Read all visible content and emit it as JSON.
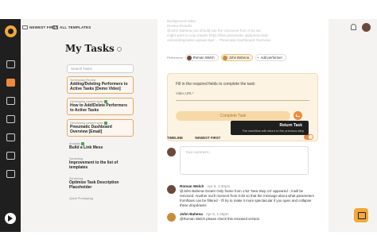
{
  "toolbar": {
    "sort_label": "NEWEST FIRST",
    "filter_label": "ALL TEMPLATES"
  },
  "tasks_panel": {
    "title": "My Tasks",
    "search_placeholder": "Search Tasks",
    "items": [
      {
        "process": "Screenplay Review",
        "title": "Adding/Deleting Performers to Active Tasks [Demo Video]",
        "boxed": true
      },
      {
        "process": "Developing content spec",
        "title": "How to Add/Delete Performers to Active Tasks",
        "boxed": true
      },
      {
        "process": "Developing content spec",
        "title": "Pneumatic Dashboard Overview [Email]",
        "boxed": true
      },
      {
        "process": "Analysis",
        "title": "Build a Link Mess",
        "boxed": false
      },
      {
        "process": "Screening",
        "title": "Improvement to the list of templates",
        "boxed": false
      },
      {
        "process": "Screening",
        "title": "Optimize Task Description Placeholder",
        "boxed": false
      },
      {
        "process": "Quick Prototyping",
        "title": "",
        "boxed": false
      }
    ]
  },
  "task_detail": {
    "previous_text": "Background video\nReview Results\n@John Bahena you should use the voiceover from 0:41 we\nmight want to crop maybe https://files.pneumatic.app/pneumatic-\nonboarding/video-upload.mp4 ... Pneumatic Dashboard Overview",
    "performers_label": "Performers",
    "performers": [
      {
        "name": "Roman Welch",
        "highlight": false
      },
      {
        "name": "John Bahena",
        "highlight": true
      }
    ],
    "add_performer": "Add performer",
    "form_heading": "Fill in the required fields to complete the task:",
    "field_label": "Video URL*",
    "complete_button": "Complete Task",
    "tooltip_title": "Return Task",
    "tooltip_text": "The workflow will return to the previous step"
  },
  "timeline": {
    "label": "TIMELINE",
    "sort": "NEWEST FIRST",
    "comments_toggle": "COMMENTS",
    "comment_placeholder": "Your comment..."
  },
  "comments": [
    {
      "author": "Roman Welch",
      "date": "Apr 5, 1:30pm",
      "text": "@John Bahena Great!! Only frame from 1:52 'New Step 1X' appeared - it will be removed. Another such moment from 0:48 so that the message about what parameters fromflows can be filtered - I'll try to make it more spectacular if you open and collapse these dropdowns"
    },
    {
      "author": "John Bahena",
      "date": "Apr 5, 1:25pm",
      "text": "@Roman Welch please check this renewed version"
    }
  ]
}
